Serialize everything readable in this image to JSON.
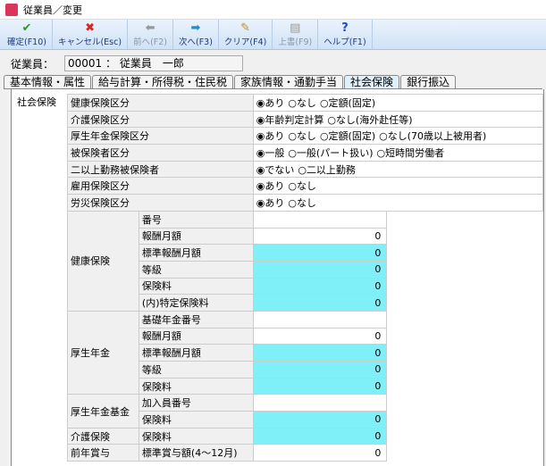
{
  "window": {
    "title": "従業員／変更",
    "logo": "給"
  },
  "toolbar": [
    {
      "label": "確定(F10)",
      "icon": "✔",
      "color": "#2a9a2a",
      "enabled": true
    },
    {
      "label": "キャンセル(Esc)",
      "icon": "✖",
      "color": "#e02020",
      "enabled": true
    },
    {
      "label": "前へ(F2)",
      "icon": "⬅",
      "color": "#999999",
      "enabled": false
    },
    {
      "label": "次へ(F3)",
      "icon": "➡",
      "color": "#1e90d0",
      "enabled": true
    },
    {
      "label": "クリア(F4)",
      "icon": "✎",
      "color": "#c09020",
      "enabled": true
    },
    {
      "label": "上書(F9)",
      "icon": "▤",
      "color": "#999999",
      "enabled": false
    },
    {
      "label": "ヘルプ(F1)",
      "icon": "?",
      "color": "#2050c0",
      "enabled": true
    }
  ],
  "employee": {
    "label": "従業員：",
    "value": "00001 ： 従業員　一郎"
  },
  "tabs": [
    "基本情報・属性",
    "給与計算・所得税・住民税",
    "家族情報・通勤手当",
    "社会保険",
    "銀行振込"
  ],
  "active_tab": 3,
  "group_label": "社会保険",
  "options": [
    {
      "label": "健康保険区分",
      "choices": [
        "あり",
        "なし",
        "定額(固定)"
      ],
      "selected": 0
    },
    {
      "label": "介護保険区分",
      "choices": [
        "年齢判定計算",
        "なし(海外赴任等)"
      ],
      "selected": 0
    },
    {
      "label": "厚生年金保険区分",
      "choices": [
        "あり",
        "なし",
        "定額(固定)",
        "なし(70歳以上被用者)"
      ],
      "selected": 0
    },
    {
      "label": "被保険者区分",
      "choices": [
        "一般",
        "一般(パート扱い)",
        "短時間労働者"
      ],
      "selected": 0
    },
    {
      "label": "二以上勤務被保険者",
      "choices": [
        "でない",
        "二以上勤務"
      ],
      "selected": 0
    },
    {
      "label": "雇用保険区分",
      "choices": [
        "あり",
        "なし"
      ],
      "selected": 0
    },
    {
      "label": "労災保険区分",
      "choices": [
        "あり",
        "なし"
      ],
      "selected": 0
    }
  ],
  "groups": [
    {
      "name": "健康保険",
      "rows": [
        {
          "label": "番号",
          "value": "",
          "cyan": false
        },
        {
          "label": "報酬月額",
          "value": "0",
          "cyan": false
        },
        {
          "label": "標準報酬月額",
          "value": "0",
          "cyan": true
        },
        {
          "label": "等級",
          "value": "0",
          "cyan": true
        },
        {
          "label": "保険料",
          "value": "0",
          "cyan": true
        },
        {
          "label": "(内)特定保険料",
          "value": "0",
          "cyan": true
        }
      ]
    },
    {
      "name": "厚生年金",
      "rows": [
        {
          "label": "基礎年金番号",
          "value": "",
          "cyan": false
        },
        {
          "label": "報酬月額",
          "value": "0",
          "cyan": false
        },
        {
          "label": "標準報酬月額",
          "value": "0",
          "cyan": true
        },
        {
          "label": "等級",
          "value": "0",
          "cyan": true
        },
        {
          "label": "保険料",
          "value": "0",
          "cyan": true
        }
      ]
    },
    {
      "name": "厚生年金基金",
      "rows": [
        {
          "label": "加入員番号",
          "value": "",
          "cyan": false
        },
        {
          "label": "保険料",
          "value": "0",
          "cyan": true
        }
      ]
    },
    {
      "name": "介護保険",
      "rows": [
        {
          "label": "保険料",
          "value": "0",
          "cyan": true
        }
      ]
    },
    {
      "name": "前年賞与",
      "rows": [
        {
          "label": "標準賞与額(4〜12月)",
          "value": "0",
          "cyan": false
        }
      ]
    }
  ]
}
